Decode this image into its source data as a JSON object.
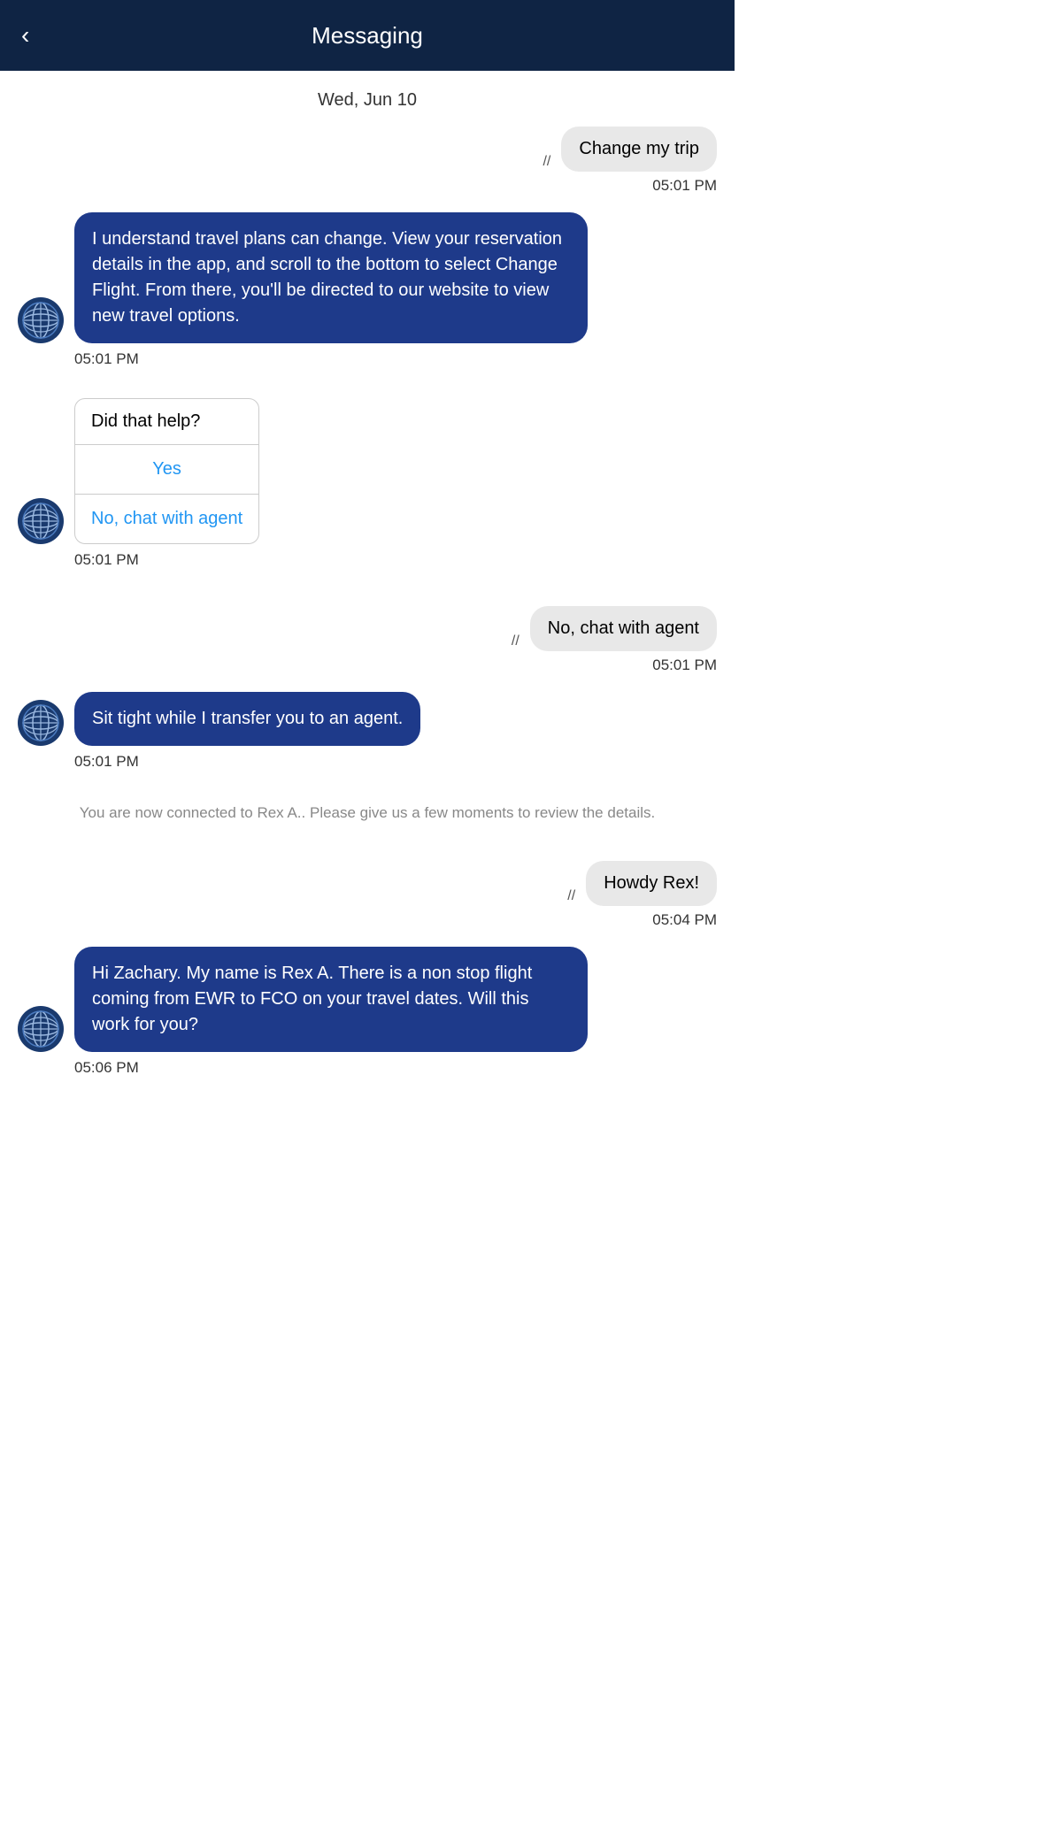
{
  "header": {
    "title": "Messaging",
    "back_label": "‹"
  },
  "date_separator": "Wed, Jun 10",
  "messages": [
    {
      "id": "msg1",
      "type": "user",
      "text": "Change my trip",
      "time": "05:01 PM",
      "checkmarks": "//"
    },
    {
      "id": "msg2",
      "type": "bot",
      "text": "I understand travel plans can change. View your reservation details in the app, and scroll to the bottom to select Change Flight. From there, you'll be directed to our website to view new travel options.",
      "time": "05:01 PM"
    },
    {
      "id": "msg3",
      "type": "bot-card",
      "question": "Did that help?",
      "options": [
        "Yes",
        "No, chat with agent"
      ],
      "time": "05:01 PM"
    },
    {
      "id": "msg4",
      "type": "user",
      "text": "No, chat with agent",
      "time": "05:01 PM",
      "checkmarks": "//"
    },
    {
      "id": "msg5",
      "type": "bot",
      "text": "Sit tight while I transfer you to an agent.",
      "time": "05:01 PM"
    },
    {
      "id": "msg6",
      "type": "system",
      "text": "You are now connected to Rex A.. Please give us a few moments to review the details."
    },
    {
      "id": "msg7",
      "type": "user",
      "text": "Howdy Rex!",
      "time": "05:04 PM",
      "checkmarks": "//"
    },
    {
      "id": "msg8",
      "type": "bot",
      "text": "Hi Zachary. My name is Rex A. There is a non stop flight coming from EWR to FCO on your travel dates. Will this work for you?",
      "time": "05:06 PM"
    }
  ],
  "colors": {
    "header_bg": "#0f2444",
    "bot_bubble_bg": "#1e3a8a",
    "user_bubble_bg": "#e8e8e8",
    "card_option_color": "#2196F3",
    "system_text": "#888888"
  }
}
